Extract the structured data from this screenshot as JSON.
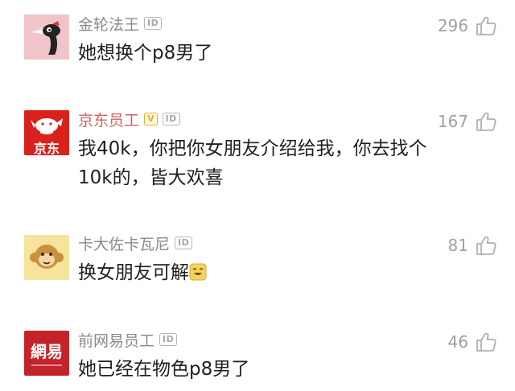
{
  "comments": [
    {
      "username": "金轮法王",
      "badges": [
        "ID"
      ],
      "text": "她想换个p8男了",
      "likes": "296",
      "avatar_icon": "woodpecker-avatar-icon"
    },
    {
      "username": "京东员工",
      "badges": [
        "V",
        "ID"
      ],
      "text": "我40k，你把你女朋友介绍给我，你去找个10k的，皆大欢喜",
      "likes": "167",
      "avatar_icon": "jd-logo-avatar-icon",
      "avatar_label": "京东"
    },
    {
      "username": "卡大佐卡瓦尼",
      "badges": [
        "ID"
      ],
      "text": "换女朋友可解",
      "likes": "81",
      "avatar_icon": "monkey-avatar-icon"
    },
    {
      "username": "前网易员工",
      "badges": [
        "ID"
      ],
      "text": "她已经在物色p8男了",
      "likes": "46",
      "avatar_icon": "netease-logo-avatar-icon",
      "avatar_label": "網易"
    }
  ],
  "colors": {
    "username": "#8a8a8a",
    "brand_username": "#d1625a",
    "like_count": "#a0a0a0",
    "jd_red": "#d9221c",
    "netease_red": "#c5232a"
  }
}
